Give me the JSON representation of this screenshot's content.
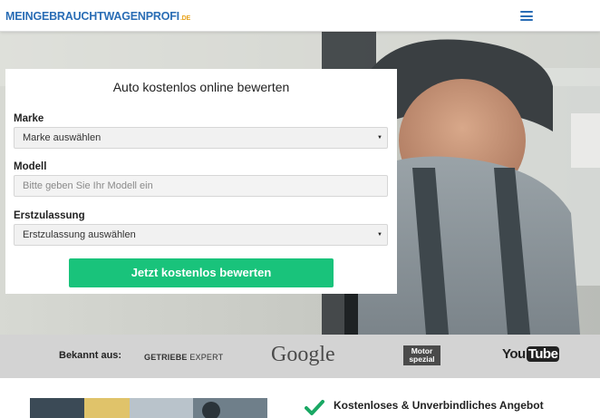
{
  "header": {
    "logo_text": "MEINGEBRAUCHTWAGENPROFI",
    "logo_tld": ".DE",
    "menu_icon": "hamburger-menu-icon"
  },
  "form": {
    "title": "Auto kostenlos online bewerten",
    "brand_label": "Marke",
    "brand_value": "Marke auswählen",
    "model_label": "Modell",
    "model_placeholder": "Bitte geben Sie Ihr Modell ein",
    "registration_label": "Erstzulassung",
    "registration_value": "Erstzulassung auswählen",
    "submit_label": "Jetzt kostenlos bewerten"
  },
  "known_from": {
    "label": "Bekannt aus:",
    "brands": {
      "getriebe_bold": "GETRIEBE",
      "getriebe_rest": "EXPERT",
      "google": "Google",
      "motor_line1": "Motor",
      "motor_line2": "spezial",
      "youtube_you": "You",
      "youtube_tube": "Tube"
    }
  },
  "benefits": {
    "first": "Kostenloses & Unverbindliches Angebot",
    "first_icon": "checkmark-icon"
  },
  "colors": {
    "brand_blue": "#2a6db5",
    "tld_orange": "#e8a21a",
    "cta_green": "#19c37b",
    "strip_gray": "#d3d3d3",
    "check_green": "#1aa864"
  }
}
